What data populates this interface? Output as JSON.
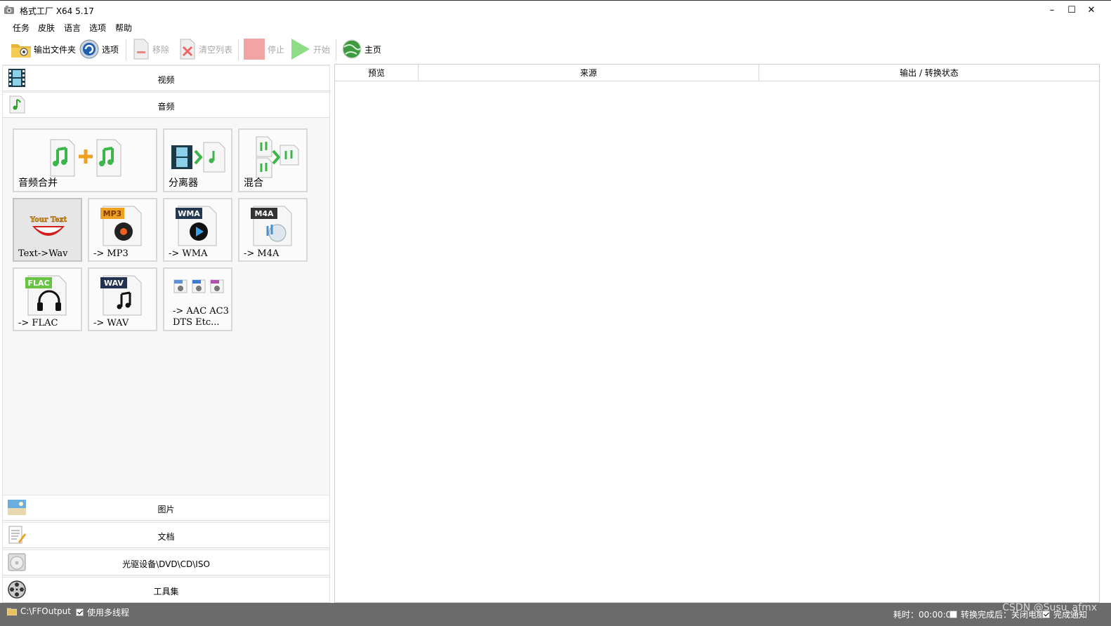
{
  "window": {
    "title": "格式工厂 X64 5.17",
    "minimize": "–",
    "maximize": "☐",
    "close": "✕"
  },
  "menu": [
    "任务",
    "皮肤",
    "语言",
    "选项",
    "帮助"
  ],
  "toolbar": {
    "output_folder": "输出文件夹",
    "options": "选项",
    "remove": "移除",
    "clear_list": "清空列表",
    "stop": "停止",
    "start": "开始",
    "home": "主页"
  },
  "categories": {
    "video": "视频",
    "audio": "音频",
    "image": "图片",
    "document": "文档",
    "optical": "光驱设备\\DVD\\CD\\ISO",
    "tools": "工具集"
  },
  "audio_tools": [
    {
      "label": "音频合并",
      "icon": "audio-merge-icon"
    },
    {
      "label": "分离器",
      "icon": "splitter-icon"
    },
    {
      "label": "混合",
      "icon": "mix-icon"
    },
    {
      "label": "Text->Wav",
      "icon": "text-to-wav-icon",
      "badge": "Your Text"
    },
    {
      "label": "-> MP3",
      "icon": "mp3-icon",
      "badge": "MP3"
    },
    {
      "label": "-> WMA",
      "icon": "wma-icon",
      "badge": "WMA"
    },
    {
      "label": "-> M4A",
      "icon": "m4a-icon",
      "badge": "M4A"
    },
    {
      "label": "-> FLAC",
      "icon": "flac-icon",
      "badge": "FLAC"
    },
    {
      "label": "-> WAV",
      "icon": "wav-icon",
      "badge": "WAV"
    },
    {
      "label_line1": "-> AAC AC3",
      "label_line2": "DTS Etc...",
      "icon": "aac-ac3-dts-icon"
    }
  ],
  "table": {
    "columns": [
      "预览",
      "来源",
      "输出 / 转换状态"
    ]
  },
  "status": {
    "output_path": "C:\\FFOutput",
    "multithread": "使用多线程",
    "elapsed": "耗时：00:00:00",
    "after_convert": "转换完成后：关闭电脑",
    "notify": "完成通知"
  },
  "watermark": "CSDN @Susu_afmx",
  "colors": {
    "statusbar": "#6b6b6b",
    "accent_green": "#3cb64a",
    "accent_orange": "#f0a020"
  }
}
